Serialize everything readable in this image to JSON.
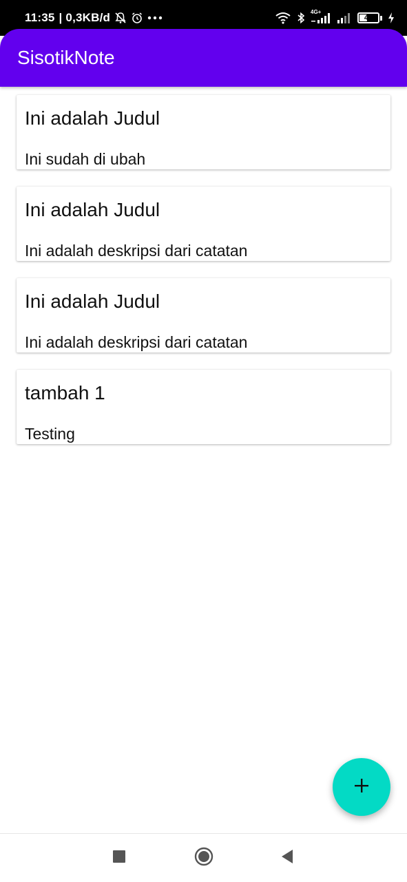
{
  "status_bar": {
    "time": "11:35",
    "net_speed": "| 0,3KB/d",
    "battery_level": "41",
    "battery_fraction": 0.41,
    "network_label": "4G+",
    "icons": [
      "silent-bell-icon",
      "alarm-icon",
      "more-dots-icon",
      "wifi-icon",
      "bluetooth-icon",
      "signal-icon",
      "signal-icon",
      "battery-icon",
      "charging-icon"
    ]
  },
  "app_bar": {
    "title": "SisotikNote",
    "color": "#6200ee"
  },
  "notes": [
    {
      "title": "Ini adalah Judul",
      "description": "Ini sudah di ubah"
    },
    {
      "title": "Ini adalah Judul",
      "description": "Ini adalah deskripsi dari catatan"
    },
    {
      "title": "Ini adalah Judul",
      "description": "Ini adalah deskripsi dari catatan"
    },
    {
      "title": "tambah 1",
      "description": "Testing"
    }
  ],
  "fab": {
    "icon": "plus-icon",
    "color": "#03dac5"
  },
  "nav_bar": {
    "icons": [
      "recents-square-icon",
      "home-circle-icon",
      "back-triangle-icon"
    ]
  }
}
